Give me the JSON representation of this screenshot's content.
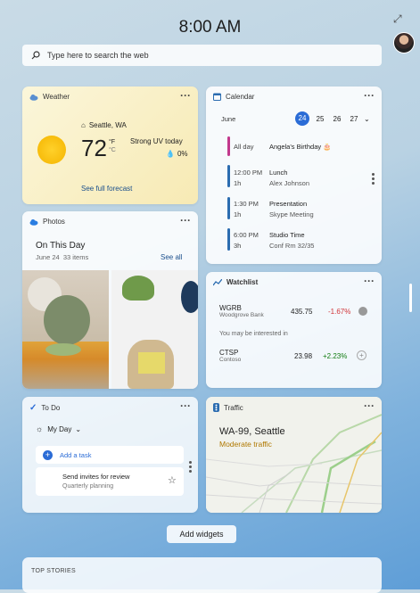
{
  "header": {
    "time": "8:00 AM"
  },
  "search": {
    "placeholder": "Type here to search the web"
  },
  "weather": {
    "title": "Weather",
    "location": "Seattle, WA",
    "temp": "72",
    "unit_f": "°F",
    "unit_c": "°C",
    "condition": "Strong UV today",
    "precip": "0%",
    "link": "See full forecast"
  },
  "calendar": {
    "title": "Calendar",
    "month": "June",
    "days": [
      "24",
      "25",
      "26",
      "27"
    ],
    "events": [
      {
        "time": "All day",
        "duration": "",
        "title": "Angela's Birthday",
        "sub": "",
        "color": "#c2388c"
      },
      {
        "time": "12:00 PM",
        "duration": "1h",
        "title": "Lunch",
        "sub": "Alex Johnson",
        "color": "#2b6cb0"
      },
      {
        "time": "1:30 PM",
        "duration": "1h",
        "title": "Presentation",
        "sub": "Skype Meeting",
        "color": "#2b6cb0"
      },
      {
        "time": "6:00 PM",
        "duration": "3h",
        "title": "Studio Time",
        "sub": "Conf Rm 32/35",
        "color": "#2b6cb0"
      }
    ]
  },
  "photos": {
    "title": "Photos",
    "heading": "On This Day",
    "date": "June 24",
    "count": "33 items",
    "link": "See all"
  },
  "watchlist": {
    "title": "Watchlist",
    "interest": "You may be interested in",
    "stocks": [
      {
        "symbol": "WGRB",
        "name": "Woodgrove Bank",
        "price": "435.75",
        "change": "-1.67%",
        "color": "#d13438"
      },
      {
        "symbol": "CTSP",
        "name": "Contoso",
        "price": "23.98",
        "change": "+2.23%",
        "color": "#107c10"
      }
    ]
  },
  "todo": {
    "title": "To Do",
    "list": "My Day",
    "add": "Add a task",
    "task": "Send invites for review",
    "task_sub": "Quarterly planning"
  },
  "traffic": {
    "title": "Traffic",
    "road": "WA-99, Seattle",
    "status": "Moderate traffic"
  },
  "buttons": {
    "add_widgets": "Add widgets"
  },
  "stories": {
    "title": "TOP STORIES"
  }
}
